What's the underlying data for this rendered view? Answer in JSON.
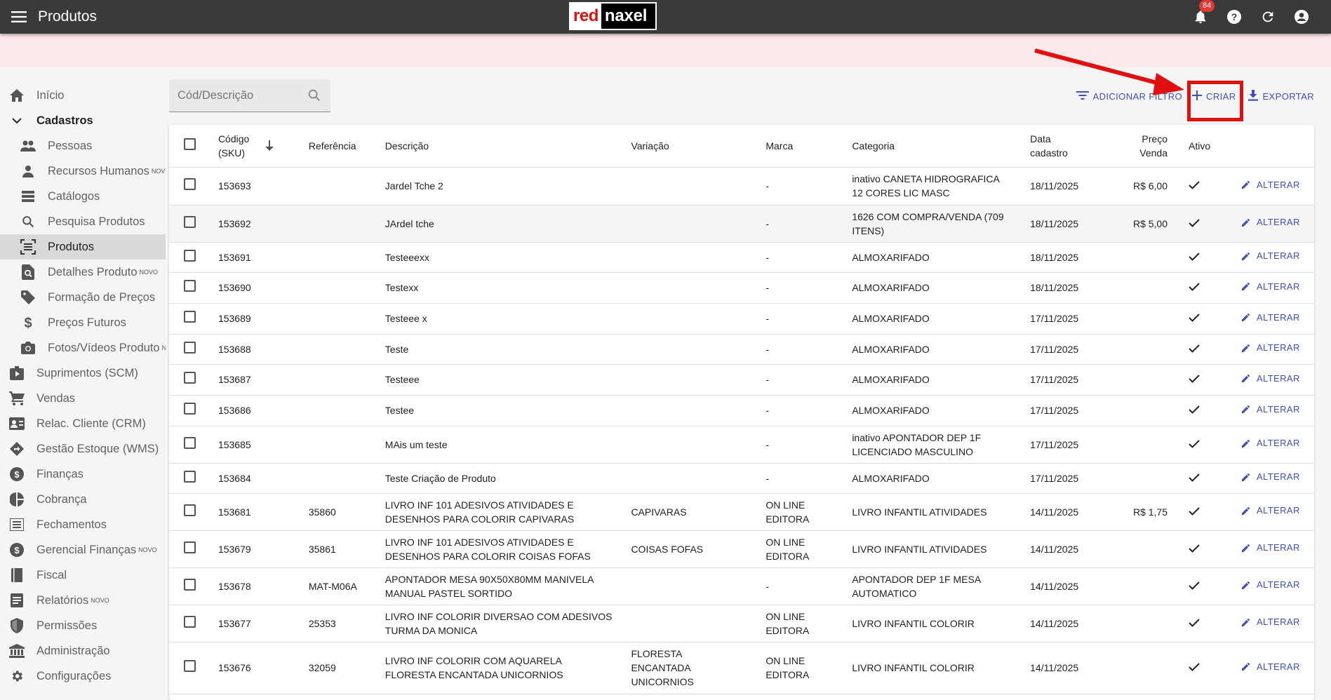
{
  "app": {
    "title": "Produtos",
    "logo_red": "red",
    "logo_rest": "naxel",
    "notifications_count": "84"
  },
  "sidebar": {
    "items": [
      {
        "label": "Início",
        "sup": "",
        "level": "top",
        "icon": "home-icon"
      },
      {
        "label": "Cadastros",
        "sup": "",
        "level": "bold",
        "icon": "chevron-down-icon"
      },
      {
        "label": "Pessoas",
        "sup": "",
        "level": "sub",
        "icon": "people-icon"
      },
      {
        "label": "Recursos Humanos",
        "sup": "NOVO",
        "level": "sub",
        "icon": "person-icon"
      },
      {
        "label": "Catálogos",
        "sup": "",
        "level": "sub",
        "icon": "list-icon"
      },
      {
        "label": "Pesquisa Produtos",
        "sup": "",
        "level": "sub",
        "icon": "search-icon"
      },
      {
        "label": "Produtos",
        "sup": "",
        "level": "sub active",
        "icon": "barcode-icon"
      },
      {
        "label": "Detalhes Produto",
        "sup": "NOVO",
        "level": "sub",
        "icon": "find-in-page-icon"
      },
      {
        "label": "Formação de Preços",
        "sup": "",
        "level": "sub",
        "icon": "tag-icon"
      },
      {
        "label": "Preços Futuros",
        "sup": "",
        "level": "sub",
        "icon": "dollar-icon"
      },
      {
        "label": "Fotos/Vídeos Produto",
        "sup": "NOVO",
        "level": "sub",
        "icon": "camera-icon"
      },
      {
        "label": "Suprimentos (SCM)",
        "sup": "",
        "level": "top",
        "icon": "business-icon"
      },
      {
        "label": "Vendas",
        "sup": "",
        "level": "top",
        "icon": "cart-icon"
      },
      {
        "label": "Relac. Cliente (CRM)",
        "sup": "",
        "level": "top",
        "icon": "contact-card-icon"
      },
      {
        "label": "Gestão Estoque (WMS)",
        "sup": "",
        "level": "top",
        "icon": "directions-icon"
      },
      {
        "label": "Finanças",
        "sup": "",
        "level": "top",
        "icon": "money-circle-icon"
      },
      {
        "label": "Cobrança",
        "sup": "",
        "level": "top",
        "icon": "pie-chart-icon"
      },
      {
        "label": "Fechamentos",
        "sup": "",
        "level": "top",
        "icon": "list-alt-icon"
      },
      {
        "label": "Gerencial Finanças",
        "sup": "NOVO",
        "level": "top",
        "icon": "money-circle-icon"
      },
      {
        "label": "Fiscal",
        "sup": "",
        "level": "top",
        "icon": "book-icon"
      },
      {
        "label": "Relatórios",
        "sup": "NOVO",
        "level": "top",
        "icon": "report-icon"
      },
      {
        "label": "Permissões",
        "sup": "",
        "level": "top",
        "icon": "shield-icon"
      },
      {
        "label": "Administração",
        "sup": "",
        "level": "top",
        "icon": "bank-icon"
      },
      {
        "label": "Configurações",
        "sup": "",
        "level": "top",
        "icon": "gear-icon"
      }
    ]
  },
  "search": {
    "placeholder": "Cód/Descrição"
  },
  "toolbar": {
    "filter_label": "ADICIONAR FILTRO",
    "create_label": "CRIAR",
    "export_label": "EXPORTAR"
  },
  "table": {
    "headers": {
      "code_line1": "Código",
      "code_line2": "(SKU)",
      "reference": "Referência",
      "description": "Descrição",
      "variation": "Variação",
      "brand": "Marca",
      "category": "Categoria",
      "date_line1": "Data",
      "date_line2": "cadastro",
      "price_line1": "Preço",
      "price_line2": "Venda",
      "active": "Ativo"
    },
    "edit_label": "ALTERAR",
    "rows": [
      {
        "code": "153693",
        "ref": "",
        "desc": "Jardel Tche 2",
        "var": "",
        "brand": "-",
        "cat": "inativo CANETA HIDROGRAFICA 12 CORES LIC MASC",
        "date": "18/11/2025",
        "price": "R$ 6,00",
        "h": 54
      },
      {
        "code": "153692",
        "ref": "",
        "desc": "JArdel tche",
        "var": "",
        "brand": "-",
        "cat": "1626 COM COMPRA/VENDA (709 ITENS)",
        "date": "18/11/2025",
        "price": "R$ 5,00",
        "h": 53,
        "hover": true
      },
      {
        "code": "153691",
        "ref": "",
        "desc": "Testeeexx",
        "var": "",
        "brand": "-",
        "cat": "ALMOXARIFADO",
        "date": "18/11/2025",
        "price": "",
        "h": 43
      },
      {
        "code": "153690",
        "ref": "",
        "desc": "Testexx",
        "var": "",
        "brand": "-",
        "cat": "ALMOXARIFADO",
        "date": "18/11/2025",
        "price": "",
        "h": 44
      },
      {
        "code": "153689",
        "ref": "",
        "desc": "Testeee x",
        "var": "",
        "brand": "-",
        "cat": "ALMOXARIFADO",
        "date": "17/11/2025",
        "price": "",
        "h": 44
      },
      {
        "code": "153688",
        "ref": "",
        "desc": "Teste",
        "var": "",
        "brand": "-",
        "cat": "ALMOXARIFADO",
        "date": "17/11/2025",
        "price": "",
        "h": 43
      },
      {
        "code": "153687",
        "ref": "",
        "desc": "Testeee",
        "var": "",
        "brand": "-",
        "cat": "ALMOXARIFADO",
        "date": "17/11/2025",
        "price": "",
        "h": 44
      },
      {
        "code": "153686",
        "ref": "",
        "desc": "Testee",
        "var": "",
        "brand": "-",
        "cat": "ALMOXARIFADO",
        "date": "17/11/2025",
        "price": "",
        "h": 44
      },
      {
        "code": "153685",
        "ref": "",
        "desc": "MAis um teste",
        "var": "",
        "brand": "-",
        "cat": "inativo APONTADOR DEP 1F LICENCIADO MASCULINO",
        "date": "17/11/2025",
        "price": "",
        "h": 53
      },
      {
        "code": "153684",
        "ref": "",
        "desc": "Teste Criação de Produto",
        "var": "",
        "brand": "-",
        "cat": "ALMOXARIFADO",
        "date": "17/11/2025",
        "price": "",
        "h": 43
      },
      {
        "code": "153681",
        "ref": "35860",
        "desc": "LIVRO INF 101 ADESIVOS ATIVIDADES E DESENHOS PARA COLORIR CAPIVARAS",
        "var": "CAPIVARAS",
        "brand": "ON LINE EDITORA",
        "cat": "LIVRO INFANTIL ATIVIDADES",
        "date": "14/11/2025",
        "price": "R$ 1,75",
        "h": 53
      },
      {
        "code": "153679",
        "ref": "35861",
        "desc": "LIVRO INF 101 ADESIVOS ATIVIDADES E DESENHOS PARA COLORIR COISAS FOFAS",
        "var": "COISAS FOFAS",
        "brand": "ON LINE EDITORA",
        "cat": "LIVRO INFANTIL ATIVIDADES",
        "date": "14/11/2025",
        "price": "",
        "h": 53
      },
      {
        "code": "153678",
        "ref": "MAT-M06A",
        "desc": "APONTADOR MESA 90X50X80MM MANIVELA MANUAL PASTEL SORTIDO",
        "var": "",
        "brand": "-",
        "cat": "APONTADOR DEP 1F MESA AUTOMATICO",
        "date": "14/11/2025",
        "price": "",
        "h": 53
      },
      {
        "code": "153677",
        "ref": "25353",
        "desc": "LIVRO INF COLORIR DIVERSAO COM ADESIVOS TURMA DA MONICA",
        "var": "",
        "brand": "ON LINE EDITORA",
        "cat": "LIVRO INFANTIL COLORIR",
        "date": "14/11/2025",
        "price": "",
        "h": 53
      },
      {
        "code": "153676",
        "ref": "32059",
        "desc": "LIVRO INF COLORIR COM AQUARELA FLORESTA ENCANTADA UNICORNIOS",
        "var": "FLORESTA ENCANTADA UNICORNIOS",
        "brand": "ON LINE EDITORA",
        "cat": "LIVRO INFANTIL COLORIR",
        "date": "14/11/2025",
        "price": "",
        "h": 74
      }
    ]
  }
}
